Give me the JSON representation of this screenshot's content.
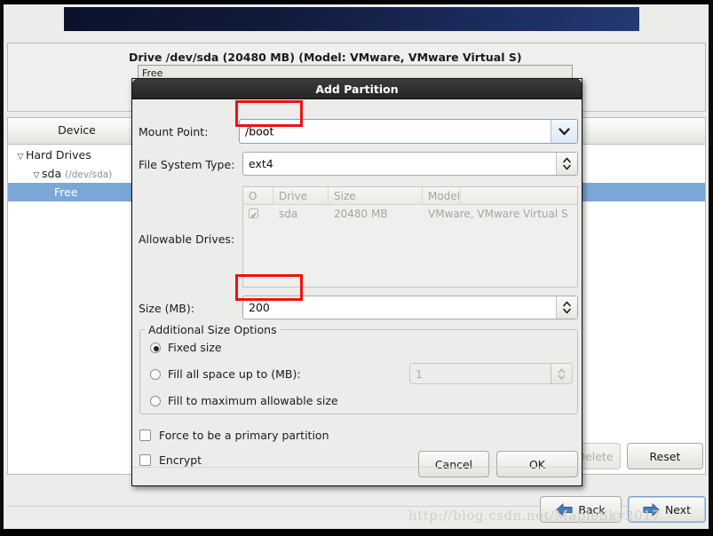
{
  "background": {
    "drive_title": "Drive /dev/sda (20480 MB) (Model: VMware, VMware Virtual S)",
    "drive_bar_label": "Free",
    "tree_column_header": "Device",
    "tree": [
      {
        "label": "Hard Drives",
        "sub": "",
        "indent": 1,
        "expander": "▽",
        "selected": false
      },
      {
        "label": "sda",
        "sub": "(/dev/sda)",
        "indent": 2,
        "expander": "▽",
        "selected": false
      },
      {
        "label": "Free",
        "sub": "",
        "indent": 3,
        "expander": "",
        "selected": true
      }
    ],
    "buttons": {
      "delete": "Delete",
      "reset": "Reset",
      "back": "Back",
      "next": "Next"
    },
    "watermark": "http://blog.csdn.net/MapleSky2017"
  },
  "dialog": {
    "title": "Add Partition",
    "mount_point": {
      "label": "Mount Point:",
      "value": "/boot",
      "dropdown_icon": "chevron-down-icon"
    },
    "file_system_type": {
      "label": "File System Type:",
      "value": "ext4",
      "spinner_icon": "up-down-arrows-icon"
    },
    "allowable_drives": {
      "label": "Allowable Drives:",
      "columns": [
        "O",
        "Drive",
        "Size",
        "Model"
      ],
      "rows": [
        {
          "checked": true,
          "drive": "sda",
          "size": "20480 MB",
          "model": "VMware, VMware Virtual S"
        }
      ]
    },
    "size": {
      "label": "Size (MB):",
      "value": "200"
    },
    "additional_size_options": {
      "title": "Additional Size Options",
      "options": [
        {
          "label": "Fixed size",
          "selected": true,
          "disabled": false
        },
        {
          "label": "Fill all space up to (MB):",
          "selected": false,
          "disabled": false
        },
        {
          "label": "Fill to maximum allowable size",
          "selected": false,
          "disabled": false
        }
      ],
      "fill_up_to_value": "1"
    },
    "checkboxes": [
      {
        "label": "Force to be a primary partition",
        "checked": false
      },
      {
        "label": "Encrypt",
        "checked": false
      }
    ],
    "buttons": {
      "cancel": "Cancel",
      "ok": "OK"
    }
  },
  "colors": {
    "selection_blue": "#7ba7d7",
    "annotation_red": "#ee1111",
    "banner_navy": "#1b2c60",
    "dialog_titlebar": "#2e2e2e"
  }
}
